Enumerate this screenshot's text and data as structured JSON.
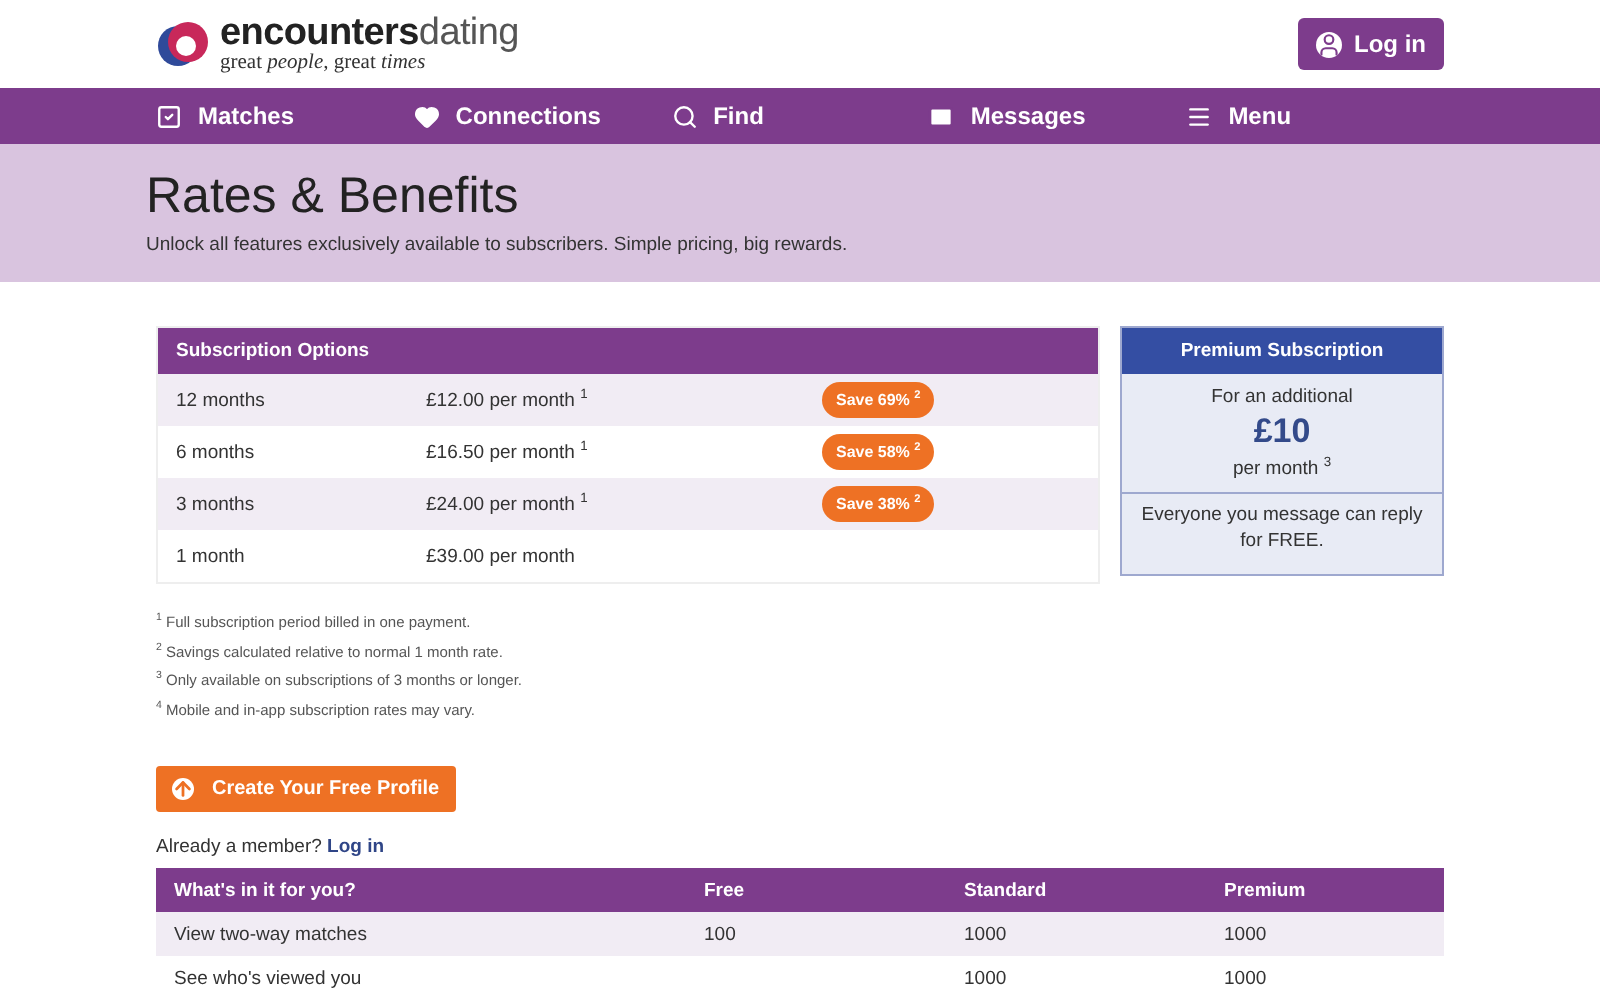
{
  "header": {
    "brand_bold": "encounters",
    "brand_light": "dating",
    "tagline": "great *people*, great *times*",
    "login": "Log in"
  },
  "nav": [
    {
      "label": "Matches"
    },
    {
      "label": "Connections"
    },
    {
      "label": "Find"
    },
    {
      "label": "Messages"
    },
    {
      "label": "Menu"
    }
  ],
  "banner": {
    "title": "Rates & Benefits",
    "subtitle": "Unlock all features exclusively available to subscribers. Simple pricing, big rewards."
  },
  "subscriptions": {
    "heading": "Subscription Options",
    "rows": [
      {
        "term": "12 months",
        "price": "£12.00 per month $^{1}$",
        "save": "Save 69% $^{2}$"
      },
      {
        "term": "6 months",
        "price": "£16.50 per month $^{1}$",
        "save": "Save 58% $^{2}$"
      },
      {
        "term": "3 months",
        "price": "£24.00 per month $^{1}$",
        "save": "Save 38% $^{2}$"
      },
      {
        "term": "1 month",
        "price": "£39.00 per month"
      }
    ]
  },
  "premium": {
    "heading": "Premium Subscription",
    "lead": "For an additional",
    "amount": "£10",
    "per": "per month $^{3}$",
    "note": "Everyone you message can reply for FREE."
  },
  "footnotes": [
    "$^{1}$ Full subscription period billed in one payment.",
    "$^{2}$ Savings calculated relative to normal 1 month rate.",
    "$^{3}$ Only available on subscriptions of 3 months or longer.",
    "$^{4}$ Mobile and in-app subscription rates may vary."
  ],
  "cta": "Create Your Free Profile",
  "member": {
    "text": "Already a member?",
    "link": "Log in"
  },
  "benefits": {
    "columns": [
      "What's in it for you?",
      "Free",
      "Standard",
      "Premium"
    ],
    "rows": [
      [
        "View two-way matches",
        "100",
        "1000",
        "1000"
      ],
      [
        "See who's viewed you",
        "",
        "1000",
        "1000"
      ]
    ]
  }
}
